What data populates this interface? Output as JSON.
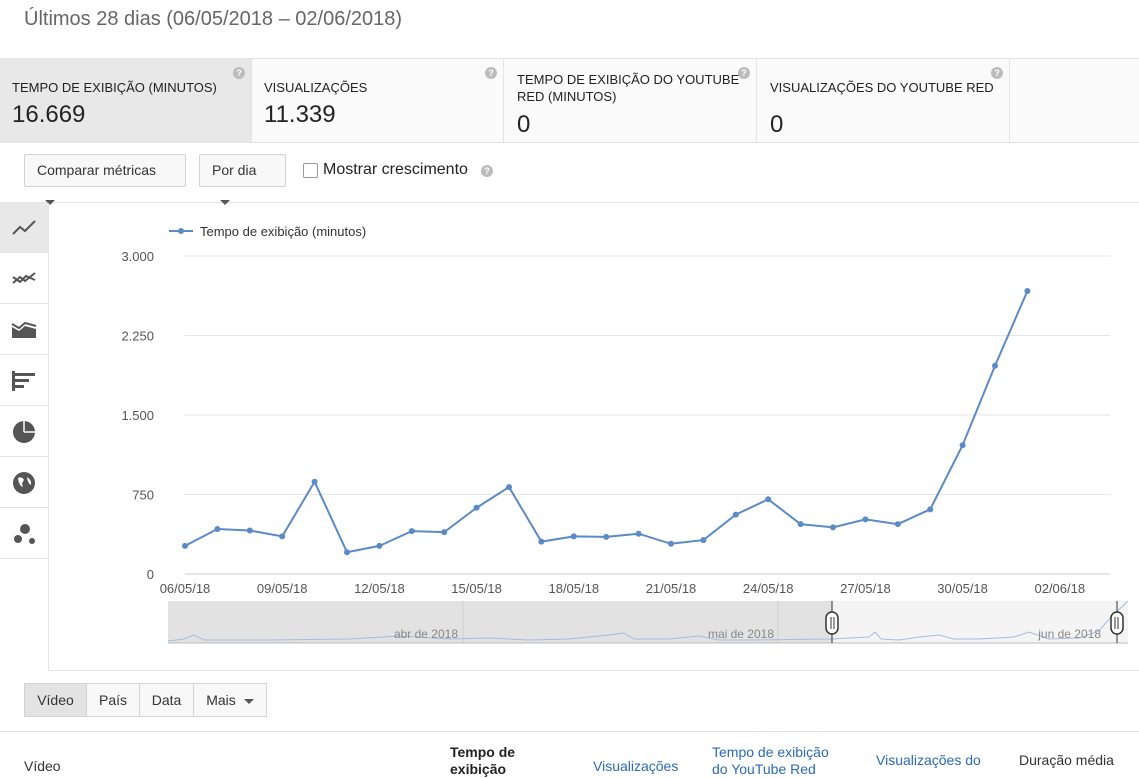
{
  "header": {
    "range_title": "Últimos 28 dias (06/05/2018 – 02/06/2018)"
  },
  "metrics": [
    {
      "label": "TEMPO DE EXIBIÇÃO (MINUTOS)",
      "value": "16.669",
      "active": true
    },
    {
      "label": "VISUALIZAÇÕES",
      "value": "11.339"
    },
    {
      "label": "TEMPO DE EXIBIÇÃO DO YOUTUBE RED (MINUTOS)",
      "value": "0"
    },
    {
      "label": "VISUALIZAÇÕES DO YOUTUBE RED",
      "value": "0"
    }
  ],
  "help_glyph": "?",
  "controls": {
    "compare_label": "Comparar métricas",
    "period_label": "Por dia",
    "growth_label": "Mostrar crescimento"
  },
  "chart_types": [
    "line-chart-icon",
    "multi-line-chart-icon",
    "stacked-area-chart-icon",
    "bar-chart-icon",
    "pie-chart-icon",
    "globe-map-icon",
    "bubble-chart-icon"
  ],
  "chart_data": {
    "type": "line",
    "legend": "Tempo de exibição (minutos)",
    "series_color": "#5b8ac6",
    "yticks": [
      "3.000",
      "2.250",
      "1.500",
      "750",
      "0"
    ],
    "ylim": [
      0,
      3000
    ],
    "xtick_labels": [
      "06/05/18",
      "09/05/18",
      "12/05/18",
      "15/05/18",
      "18/05/18",
      "21/05/18",
      "24/05/18",
      "27/05/18",
      "30/05/18",
      "02/06/18"
    ],
    "x": [
      "06/05/18",
      "07/05/18",
      "08/05/18",
      "09/05/18",
      "10/05/18",
      "11/05/18",
      "12/05/18",
      "13/05/18",
      "14/05/18",
      "15/05/18",
      "16/05/18",
      "17/05/18",
      "18/05/18",
      "19/05/18",
      "20/05/18",
      "21/05/18",
      "22/05/18",
      "23/05/18",
      "24/05/18",
      "25/05/18",
      "26/05/18",
      "27/05/18",
      "28/05/18",
      "29/05/18",
      "30/05/18",
      "31/05/18",
      "01/06/18"
    ],
    "values": [
      265,
      425,
      410,
      355,
      870,
      205,
      265,
      405,
      395,
      625,
      820,
      305,
      355,
      350,
      380,
      285,
      320,
      560,
      705,
      470,
      440,
      515,
      470,
      610,
      1215,
      1965,
      2670
    ],
    "navigator_labels": [
      "abr de 2018",
      "mai de 2018",
      "jun de 2018"
    ]
  },
  "tabs": [
    {
      "label": "Vídeo",
      "active": true
    },
    {
      "label": "País"
    },
    {
      "label": "Data"
    },
    {
      "label": "Mais"
    }
  ],
  "table_headers": {
    "col1": "Vídeo",
    "col2": "Tempo de exibição",
    "col3": "Visualizações",
    "col4": "Tempo de exibição do YouTube Red",
    "col5": "Visualizações do",
    "col6": "Duração média"
  }
}
